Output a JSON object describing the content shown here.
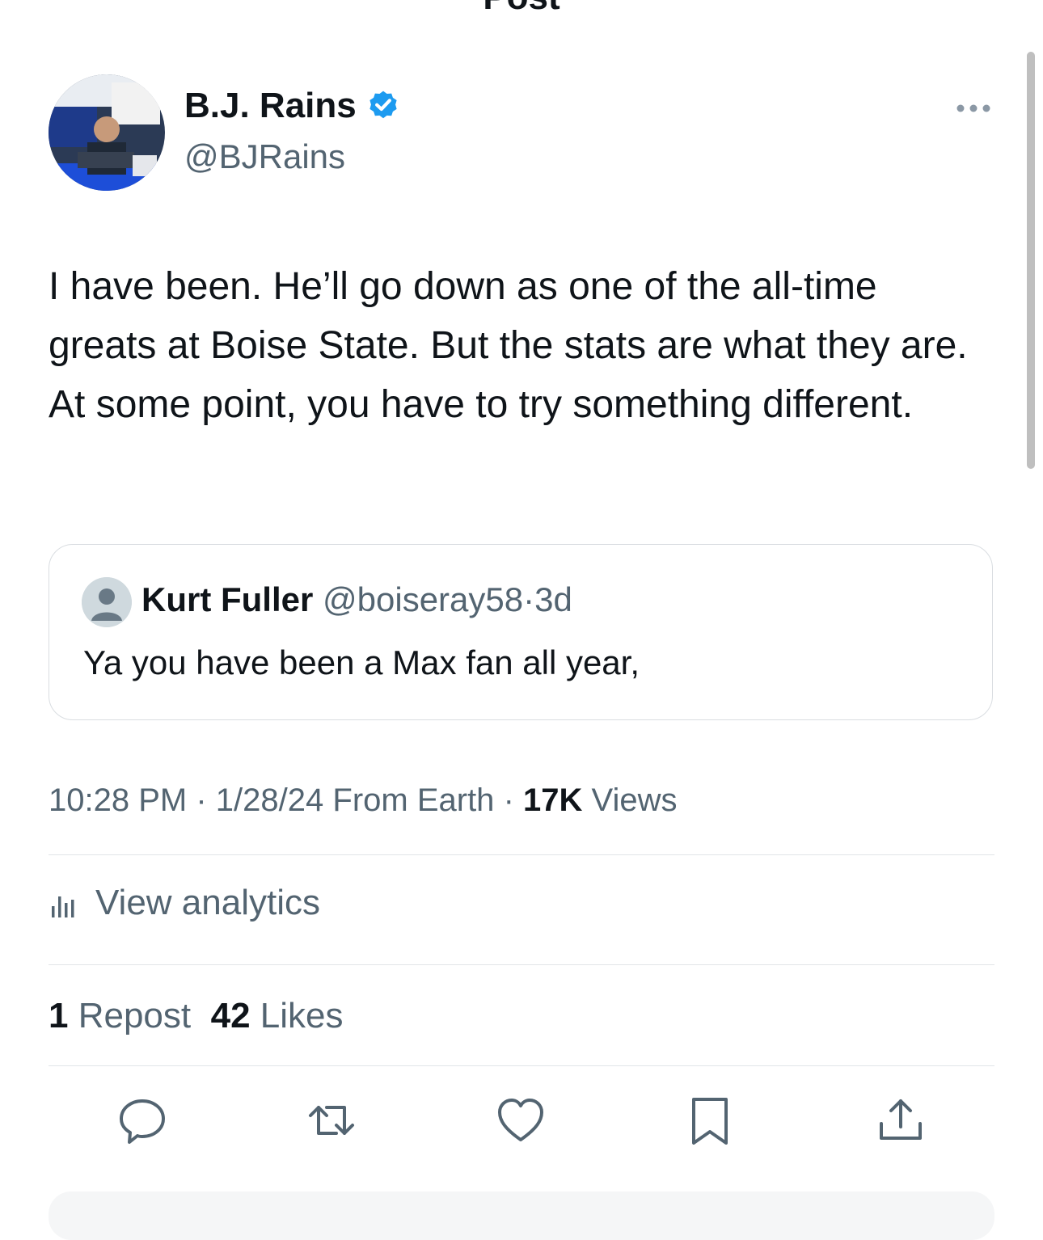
{
  "header": {
    "title": "Post",
    "back_icon": "back-arrow-icon"
  },
  "author": {
    "name": "B.J. Rains",
    "handle": "@BJRains",
    "verified": true,
    "verified_color": "#1d9bf0"
  },
  "tweet": {
    "text": "I have been. He’ll go down as one of the all-time greats at Boise State. But the stats are what they are. At some point, you have to try something different."
  },
  "quote": {
    "name": "Kurt Fuller",
    "handle": "@boiseray58",
    "separator": "·",
    "time": "3d",
    "text": "Ya you have been a Max fan all year,"
  },
  "meta": {
    "time": "10:28 PM",
    "separator": "·",
    "date": "1/28/24",
    "source": "From Earth",
    "views_count": "17K",
    "views_label": "Views"
  },
  "analytics": {
    "label": "View analytics"
  },
  "stats": {
    "reposts_count": "1",
    "reposts_label": "Repost",
    "likes_count": "42",
    "likes_label": "Likes"
  },
  "actions": [
    "reply-icon",
    "repost-icon",
    "like-icon",
    "bookmark-icon",
    "share-icon"
  ],
  "colors": {
    "text_primary": "#0f1419",
    "text_secondary": "#536471",
    "border": "#d9dde1",
    "accent": "#1d9bf0"
  }
}
